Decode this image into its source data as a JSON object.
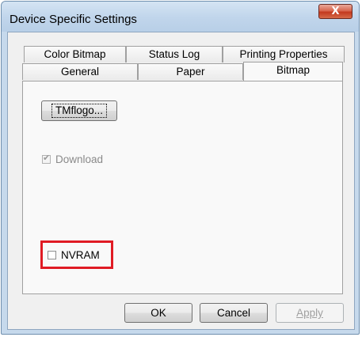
{
  "window": {
    "title": "Device Specific Settings",
    "close_glyph": "X"
  },
  "tabs_back_row": [
    {
      "label": "Color Bitmap"
    },
    {
      "label": "Status Log"
    },
    {
      "label": "Printing Properties"
    }
  ],
  "tabs_front_row": [
    {
      "label": "General"
    },
    {
      "label": "Paper"
    },
    {
      "label": "Bitmap",
      "active": true
    }
  ],
  "bitmap_tab": {
    "logo_button_label": "TMflogo...",
    "download": {
      "label": "Download",
      "checked": true,
      "enabled": false
    },
    "nvram": {
      "label": "NVRAM",
      "checked": false,
      "enabled": true,
      "highlighted": true
    }
  },
  "footer": {
    "ok_label": "OK",
    "cancel_label": "Cancel",
    "apply_label": "Apply",
    "apply_enabled": false
  },
  "colors": {
    "highlight": "#e01b24",
    "title_bar": "#c6d9ec",
    "close_button": "#c3391f"
  }
}
